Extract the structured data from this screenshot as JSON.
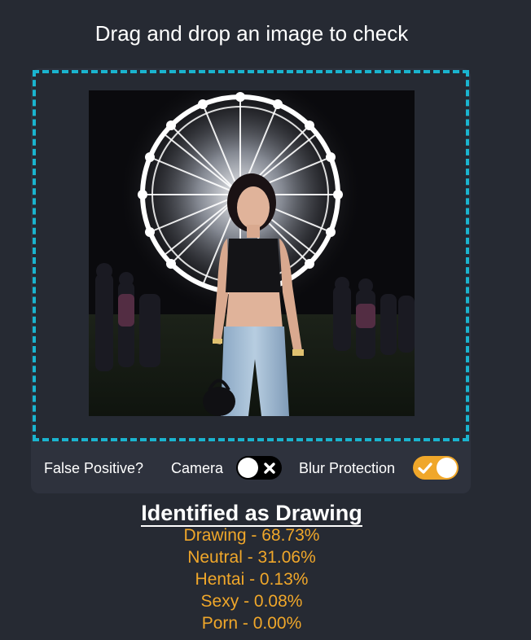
{
  "header": {
    "title": "Drag and drop an image to check"
  },
  "dropzone": {
    "border_color": "#1ab4cf",
    "preview_subject": "woman-standing-in-front-of-illuminated-ferris-wheel-at-night"
  },
  "controls": {
    "false_positive_label": "False Positive?",
    "camera_label": "Camera",
    "camera_enabled": false,
    "camera_toggle_icon": "x-icon",
    "blur_label": "Blur Protection",
    "blur_enabled": true,
    "blur_toggle_icon": "check-icon"
  },
  "result": {
    "title": "Identified as Drawing",
    "scores": [
      "Drawing - 68.73%",
      "Neutral - 31.06%",
      "Hentai - 0.13%",
      "Sexy - 0.08%",
      "Porn - 0.00%"
    ]
  },
  "colors": {
    "background": "#262a33",
    "panel": "#2e323d",
    "accent": "#f0a72a",
    "dropzone_border": "#1ab4cf",
    "text": "#ffffff"
  }
}
